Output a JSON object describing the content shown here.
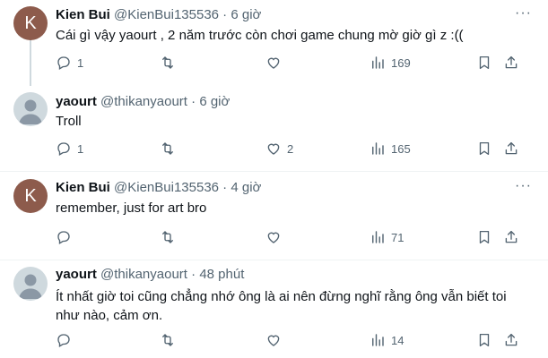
{
  "tweets": [
    {
      "avatar_letter": "K",
      "name": "Kien Bui",
      "handle": "@KienBui135536",
      "time": "6 giờ",
      "text": "Cái gì vậy yaourt , 2 năm trước còn chơi game chung mờ giờ gì z :((",
      "replies": "1",
      "retweets": "",
      "likes": "",
      "views": "169"
    },
    {
      "avatar_letter": "",
      "name": "yaourt",
      "handle": "@thikanyaourt",
      "time": "6 giờ",
      "text": "Troll",
      "replies": "1",
      "retweets": "",
      "likes": "2",
      "views": "165"
    },
    {
      "avatar_letter": "K",
      "name": "Kien Bui",
      "handle": "@KienBui135536",
      "time": "4 giờ",
      "text": "remember, just for art bro",
      "replies": "",
      "retweets": "",
      "likes": "",
      "views": "71"
    },
    {
      "avatar_letter": "",
      "name": "yaourt",
      "handle": "@thikanyaourt",
      "time": "48 phút",
      "text": "Ít nhất giờ toi cũng chẳng nhớ ông là ai nên đừng nghĩ rằng ông vẫn biết toi như nào, cảm ơn.",
      "replies": "",
      "retweets": "",
      "likes": "",
      "views": "14"
    }
  ],
  "separator": "·",
  "more_label": "···",
  "colors": {
    "text": "#0f1419",
    "secondary": "#536471",
    "thread_line": "#cfd9de",
    "avatar_k": "#8d5b4c",
    "avatar_default": "#cfd9de"
  },
  "icons": [
    "reply-icon",
    "retweet-icon",
    "like-icon",
    "views-icon",
    "bookmark-icon",
    "share-icon",
    "more-icon"
  ]
}
